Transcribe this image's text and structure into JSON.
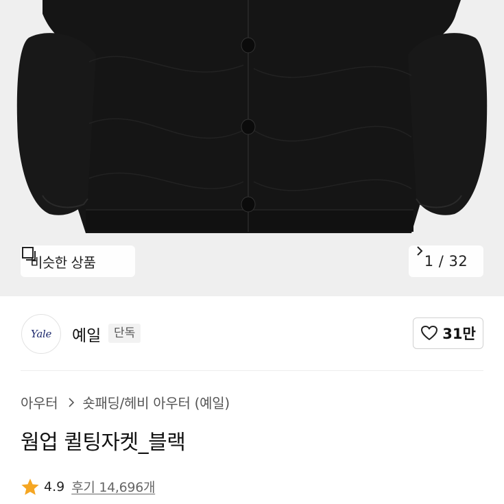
{
  "gallery": {
    "similar_button_label": "비슷한 상품",
    "counter_label": "1 / 32",
    "product_image_icon": "jacket-photo"
  },
  "brand": {
    "logo_text": "Yale",
    "name": "예일",
    "badge": "단독"
  },
  "like": {
    "count": "31만"
  },
  "breadcrumb": {
    "items": [
      "아우터",
      "숏패딩/헤비 아우터 (예일)"
    ]
  },
  "product": {
    "title": "웜업 퀼팅자켓_블랙"
  },
  "rating": {
    "score": "4.9",
    "reviews_label": "후기 14,696개"
  },
  "colors": {
    "star": "#f5a623",
    "logo": "#1e2a6e",
    "hero_background": "#efefef",
    "jacket": "#141414"
  }
}
